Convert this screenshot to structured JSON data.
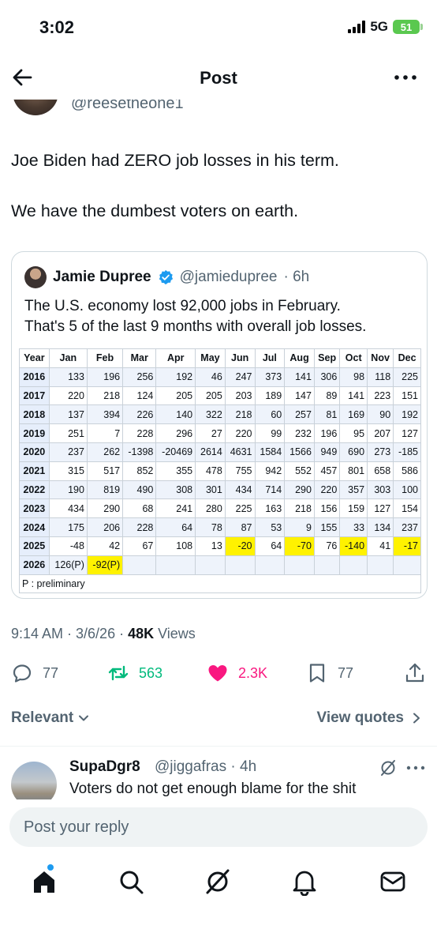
{
  "status_bar": {
    "time": "3:02",
    "network": "5G",
    "battery": "51"
  },
  "header": {
    "title": "Post"
  },
  "post": {
    "author_handle": "@reesetheone1",
    "paragraphs": [
      "Joe Biden had ZERO job losses in his term.",
      "We have the dumbest voters on earth."
    ],
    "timestamp": "9:14 AM · 3/6/26 · ",
    "views_count": "48K",
    "views_label": " Views"
  },
  "quote": {
    "name": "Jamie Dupree",
    "handle": "@jamiedupree",
    "time": "· 6h",
    "text_lines": [
      "The U.S. economy lost 92,000 jobs in February.",
      "That's 5 of the last 9 months with overall job losses."
    ],
    "table": {
      "headers": [
        "Year",
        "Jan",
        "Feb",
        "Mar",
        "Apr",
        "May",
        "Jun",
        "Jul",
        "Aug",
        "Sep",
        "Oct",
        "Nov",
        "Dec"
      ],
      "rows": [
        [
          "2016",
          "133",
          "196",
          "256",
          "192",
          "46",
          "247",
          "373",
          "141",
          "306",
          "98",
          "118",
          "225"
        ],
        [
          "2017",
          "220",
          "218",
          "124",
          "205",
          "205",
          "203",
          "189",
          "147",
          "89",
          "141",
          "223",
          "151"
        ],
        [
          "2018",
          "137",
          "394",
          "226",
          "140",
          "322",
          "218",
          "60",
          "257",
          "81",
          "169",
          "90",
          "192"
        ],
        [
          "2019",
          "251",
          "7",
          "228",
          "296",
          "27",
          "220",
          "99",
          "232",
          "196",
          "95",
          "207",
          "127"
        ],
        [
          "2020",
          "237",
          "262",
          "-1398",
          "-20469",
          "2614",
          "4631",
          "1584",
          "1566",
          "949",
          "690",
          "273",
          "-185"
        ],
        [
          "2021",
          "315",
          "517",
          "852",
          "355",
          "478",
          "755",
          "942",
          "552",
          "457",
          "801",
          "658",
          "586"
        ],
        [
          "2022",
          "190",
          "819",
          "490",
          "308",
          "301",
          "434",
          "714",
          "290",
          "220",
          "357",
          "303",
          "100"
        ],
        [
          "2023",
          "434",
          "290",
          "68",
          "241",
          "280",
          "225",
          "163",
          "218",
          "156",
          "159",
          "127",
          "154"
        ],
        [
          "2024",
          "175",
          "206",
          "228",
          "64",
          "78",
          "87",
          "53",
          "9",
          "155",
          "33",
          "134",
          "237"
        ],
        [
          "2025",
          "-48",
          "42",
          "67",
          "108",
          "13",
          "-20",
          "64",
          "-70",
          "76",
          "-140",
          "41",
          "-17"
        ],
        [
          "2026",
          "126(P)",
          "-92(P)",
          "",
          "",
          "",
          "",
          "",
          "",
          "",
          "",
          "",
          ""
        ]
      ],
      "highlighted": [
        "9-6",
        "9-8",
        "9-10",
        "9-12",
        "10-2"
      ],
      "note": "P : preliminary"
    }
  },
  "actions": {
    "replies": "77",
    "reposts": "563",
    "likes": "2.3K",
    "bookmarks": "77"
  },
  "sort": {
    "relevant": "Relevant",
    "view_quotes": "View quotes"
  },
  "reply": {
    "name": "SupaDgr8",
    "handle": "@jiggafras",
    "time": "· 4h",
    "text": "Voters do not get enough  blame for the shit"
  },
  "composer": {
    "placeholder": "Post your reply"
  },
  "colors": {
    "accent": "#1d9bf0",
    "repost": "#00ba7c",
    "like": "#f91880",
    "highlight": "#fff200"
  }
}
